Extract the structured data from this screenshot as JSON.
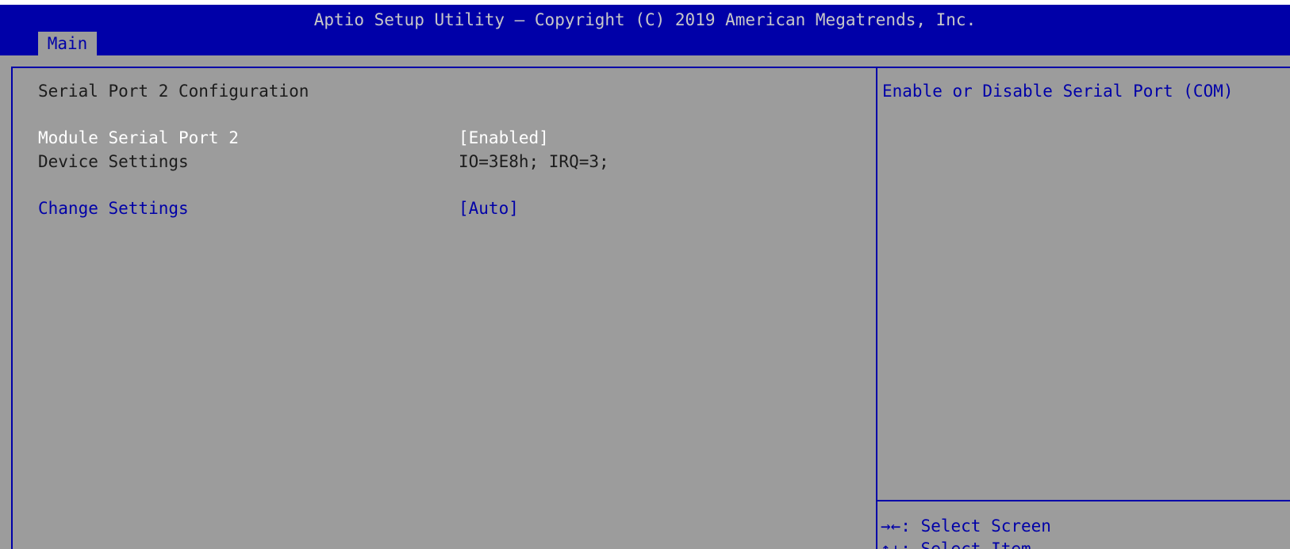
{
  "header": {
    "title": "Aptio Setup Utility – Copyright (C) 2019 American Megatrends, Inc.",
    "tabs": [
      {
        "label": "Main"
      }
    ]
  },
  "main": {
    "section_title": "Serial Port 2 Configuration",
    "items": [
      {
        "label": "Module Serial Port 2",
        "value": "[Enabled]"
      },
      {
        "label": "Device Settings",
        "value": "IO=3E8h; IRQ=3;"
      },
      {
        "label": "Change Settings",
        "value": "[Auto]"
      }
    ]
  },
  "help": {
    "description": "Enable or Disable Serial Port (COM)",
    "keys": [
      {
        "key": "→←",
        "action": ": Select Screen"
      },
      {
        "key": "↑↓",
        "action": ": Select Item"
      }
    ]
  },
  "colors": {
    "header_bg": "#0000a8",
    "panel_bg": "#9c9c9c",
    "selectable_text": "#0000a8",
    "label_text": "#ffffff"
  }
}
